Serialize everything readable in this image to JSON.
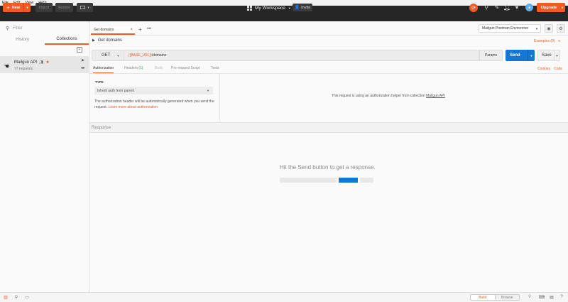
{
  "menu": [
    "File",
    "Edit",
    "View",
    "Help"
  ],
  "toolbar": {
    "new_label": "New",
    "import_label": "Import",
    "runner_label": "Runner",
    "workspace_label": "My Workspace",
    "invite_label": "Invite",
    "upgrade_label": "Upgrade"
  },
  "sidebar": {
    "filter_placeholder": "Filter",
    "tabs": [
      "History",
      "Collections"
    ],
    "active_tab": "Collections",
    "collection": {
      "name": "Mailgun API",
      "count": "77 requests"
    }
  },
  "request_tab": {
    "label": "Get domains"
  },
  "environment": {
    "selected": "Mailgun Postman Environmer"
  },
  "request": {
    "name": "Get domains",
    "examples": "Examples (0)",
    "method": "GET",
    "url_var": "{{BASE_URL}}",
    "url_path": "/domains",
    "params_label": "Params",
    "send_label": "Send",
    "save_label": "Save"
  },
  "subtabs": {
    "authorization": "Authorization",
    "headers": "Headers",
    "headers_count": "(1)",
    "body": "Body",
    "pre_request": "Pre-request Script",
    "tests": "Tests",
    "cookies": "Cookies",
    "code": "Code"
  },
  "auth": {
    "type_label": "TYPE",
    "type_value": "Inherit auth from parent",
    "note": "The authorization header will be automatically generated when you send the request.",
    "learn_more": "Learn more about authorization",
    "helper_text": "This request is using an authorization helper from collection",
    "helper_link": "Mailgun API"
  },
  "response": {
    "header": "Response",
    "empty_message": "Hit the Send button to get a response."
  },
  "statusbar": {
    "build": "Build",
    "browse": "Browse"
  },
  "colors": {
    "accent": "#ef5b25",
    "primary": "#1677d3",
    "toolbar_bg": "#262626"
  }
}
